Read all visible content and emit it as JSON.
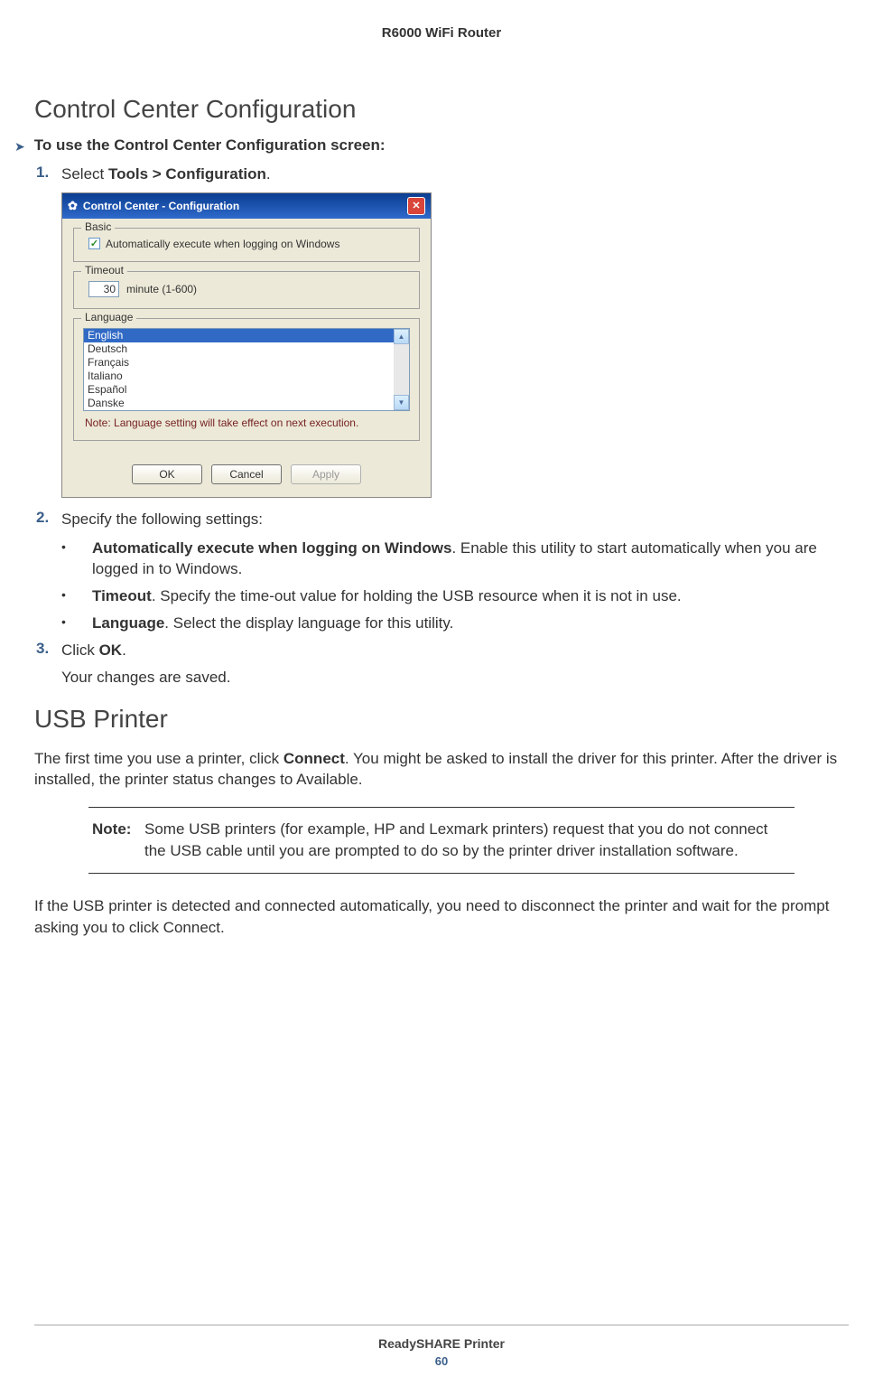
{
  "doc_header": "R6000 WiFi Router",
  "section1_title": "Control Center Configuration",
  "proc_heading": "To use the Control Center Configuration screen:",
  "step1": {
    "num": "1.",
    "prefix": "Select ",
    "bold": "Tools > Configuration",
    "suffix": "."
  },
  "dialog": {
    "title": "Control Center - Configuration",
    "basic": {
      "legend": "Basic",
      "checkbox_checked": true,
      "label": "Automatically execute when logging on Windows"
    },
    "timeout": {
      "legend": "Timeout",
      "value": "30",
      "unit": "minute (1-600)"
    },
    "language": {
      "legend": "Language",
      "items": [
        "English",
        "Deutsch",
        "Français",
        "Italiano",
        "Español",
        "Danske"
      ],
      "selected_index": 0,
      "note": "Note: Language setting will take effect on next execution."
    },
    "buttons": {
      "ok": "OK",
      "cancel": "Cancel",
      "apply": "Apply"
    }
  },
  "step2": {
    "num": "2.",
    "text": "Specify the following settings:",
    "bullets": [
      {
        "bold": "Automatically execute when logging on Windows",
        "rest": ". Enable this utility to start automatically when you are logged in to Windows."
      },
      {
        "bold": "Timeout",
        "rest": ". Specify the time-out value for holding the USB resource when it is not in use."
      },
      {
        "bold": "Language",
        "rest": ". Select the display language for this utility."
      }
    ]
  },
  "step3": {
    "num": "3.",
    "prefix": "Click ",
    "bold": "OK",
    "suffix": ".",
    "sub": "Your changes are saved."
  },
  "section2_title": "USB Printer",
  "usb_para": {
    "p1a": "The first time you use a printer, click ",
    "p1b": "Connect",
    "p1c": ". You might be asked to install the driver for this printer. After the driver is installed, the printer status changes to Available."
  },
  "note": {
    "label": "Note:",
    "text": "Some USB printers (for example, HP and Lexmark printers) request that you do not connect the USB cable until you are prompted to do so by the printer driver installation software."
  },
  "usb_para2": "If the USB printer is detected and connected automatically, you need to disconnect the printer and wait for the prompt asking you to click Connect.",
  "footer": {
    "title": "ReadySHARE Printer",
    "page": "60"
  }
}
